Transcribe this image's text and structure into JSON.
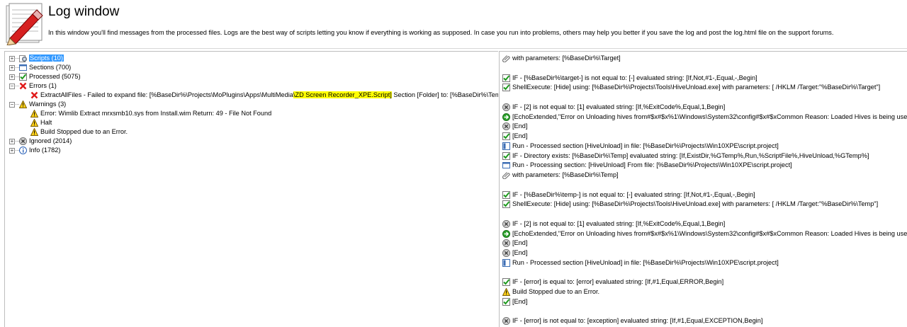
{
  "header": {
    "title": "Log window",
    "description": "In this window you'll find messages from the processed files. Logs are the best way of scripts letting you know if everything is working as supposed. In case you run into problems, others may help you better if you save the log and post the log.html file on the support forums."
  },
  "tree": {
    "scripts": "Scripts (10)",
    "sections": "Sections (700)",
    "processed": "Processed (5075)",
    "errors": "Errors (1)",
    "error_item_prefix": "ExtractAllFiles - Failed to expand file: [%BaseDir%\\Projects\\MoPlugins\\Apps\\MultiMedia",
    "error_item_highlight": "\\ZD Screen Recorder_XPE.Script]",
    "error_item_suffix": " Section [Folder] to: [%BaseDir%\\Temp\\Scre",
    "warnings": "Warnings (3)",
    "warning_1": "Error: Wimlib Extract mrxsmb10.sys from Install.wim Return: 49 - File Not Found",
    "warning_2": "Halt",
    "warning_3": "Build Stopped due to an Error.",
    "ignored": "Ignored (2014)",
    "info": "Info (1782)"
  },
  "log": [
    {
      "icon": "param",
      "text": "with parameters: [%BaseDir%\\Target]"
    },
    {
      "icon": "none",
      "text": ""
    },
    {
      "icon": "check",
      "text": "IF -  [%BaseDir%\\target-] is not equal to: [-] evaluated string: [If,Not,#1-,Equal,-,Begin]"
    },
    {
      "icon": "check",
      "text": "ShellExecute: [Hide] using: [%BaseDir%\\Projects\\Tools\\HiveUnload.exe] with parameters: [ /HKLM /Target:\"%BaseDir%\\Target\"]"
    },
    {
      "icon": "none",
      "text": ""
    },
    {
      "icon": "ignored",
      "text": "IF -  [2] is not equal to: [1] evaluated string: [If,%ExitCode%,Equal,1,Begin]"
    },
    {
      "icon": "arrow",
      "text": "[EchoExtended,\"Error on Unloading hives from#$x#$x%1\\Windows\\System32\\config#$x#$xCommon Reason: Loaded Hives is being used by"
    },
    {
      "icon": "ignored",
      "text": "[End]"
    },
    {
      "icon": "check",
      "text": "[End]"
    },
    {
      "icon": "run",
      "text": "Run - Processed section [HiveUnload] in file: [%BaseDir%\\Projects\\Win10XPE\\script.project]"
    },
    {
      "icon": "check",
      "text": "IF - Directory exists: [%BaseDir%\\Temp] evaluated string: [If,ExistDir,%GTemp%,Run,%ScriptFile%,HiveUnload,%GTemp%]"
    },
    {
      "icon": "section",
      "text": "Run - Processing section: [HiveUnload]  From file: [%BaseDir%\\Projects\\Win10XPE\\script.project]"
    },
    {
      "icon": "param",
      "text": "with parameters: [%BaseDir%\\Temp]"
    },
    {
      "icon": "none",
      "text": ""
    },
    {
      "icon": "check",
      "text": "IF -  [%BaseDir%\\temp-] is not equal to: [-] evaluated string: [If,Not,#1-,Equal,-,Begin]"
    },
    {
      "icon": "check",
      "text": "ShellExecute: [Hide] using: [%BaseDir%\\Projects\\Tools\\HiveUnload.exe] with parameters: [ /HKLM /Target:\"%BaseDir%\\Temp\"]"
    },
    {
      "icon": "none",
      "text": ""
    },
    {
      "icon": "ignored",
      "text": "IF -  [2] is not equal to: [1] evaluated string: [If,%ExitCode%,Equal,1,Begin]"
    },
    {
      "icon": "arrow",
      "text": "[EchoExtended,\"Error on Unloading hives from#$x#$x%1\\Windows\\System32\\config#$x#$xCommon Reason: Loaded Hives is being used by"
    },
    {
      "icon": "ignored",
      "text": "[End]"
    },
    {
      "icon": "ignored",
      "text": "[End]"
    },
    {
      "icon": "run",
      "text": "Run - Processed section [HiveUnload] in file: [%BaseDir%\\Projects\\Win10XPE\\script.project]"
    },
    {
      "icon": "none",
      "text": ""
    },
    {
      "icon": "check",
      "text": "IF -  [error] is equal to: [error] evaluated string: [If,#1,Equal,ERROR,Begin]"
    },
    {
      "icon": "warning",
      "text": "Build Stopped due to an Error."
    },
    {
      "icon": "check",
      "text": "[End]"
    },
    {
      "icon": "none",
      "text": ""
    },
    {
      "icon": "ignored",
      "text": "IF -  [error] is not equal to: [exception] evaluated string: [If,#1,Equal,EXCEPTION,Begin]"
    }
  ]
}
